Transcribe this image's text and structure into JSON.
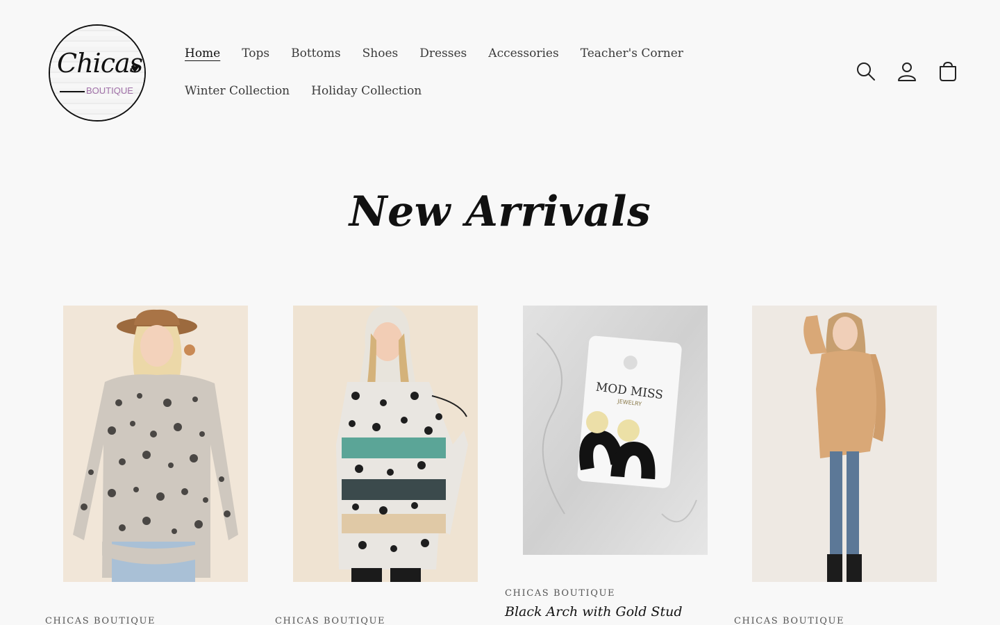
{
  "header": {
    "logo": {
      "script": "Chicas",
      "sub": "BOUTIQUE"
    },
    "nav": {
      "row1": [
        {
          "label": "Home",
          "active": true
        },
        {
          "label": "Tops"
        },
        {
          "label": "Bottoms"
        },
        {
          "label": "Shoes"
        },
        {
          "label": "Dresses"
        },
        {
          "label": "Accessories"
        },
        {
          "label": "Teacher's Corner"
        }
      ],
      "row2": [
        {
          "label": "Winter Collection"
        },
        {
          "label": "Holiday Collection"
        }
      ]
    },
    "icons": [
      "search-icon",
      "account-icon",
      "cart-icon"
    ]
  },
  "section": {
    "title": "New Arrivals"
  },
  "products": [
    {
      "brand": "CHICAS BOUTIQUE",
      "name": "",
      "image": "leopard-longsleeve-hat"
    },
    {
      "brand": "CHICAS BOUTIQUE",
      "name": "",
      "image": "leopard-hoodie"
    },
    {
      "brand": "CHICAS BOUTIQUE",
      "name": "Black Arch with Gold Stud",
      "image": "arch-earrings",
      "card_text": "MOD MISS",
      "card_subtext": "JEWELRY"
    },
    {
      "brand": "CHICAS BOUTIQUE",
      "name": "",
      "image": "camel-bell-sleeve"
    }
  ],
  "colors": {
    "background": "#f8f8f8",
    "text": "#222222",
    "logo_accent": "#a070a8"
  }
}
